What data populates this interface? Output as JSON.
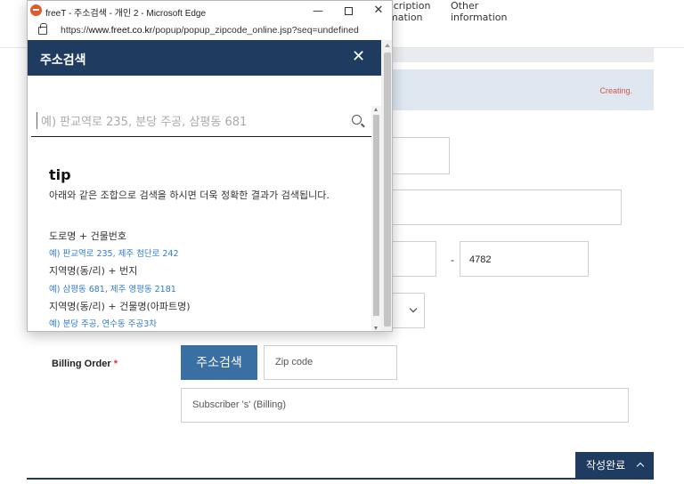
{
  "window": {
    "title": "freeT - 주소검색 - 개인 2 - Microsoft Edge",
    "url_prefix": "https://",
    "url_host": "www.freet.co.kr",
    "url_path": "/popup/popup_zipcode_online.jsp?seq=undefined",
    "controls": {
      "minimize": "—",
      "maximize": "",
      "close": "✕"
    }
  },
  "popup": {
    "header_title": "주소검색",
    "close": "✕",
    "search": {
      "placeholder": "예) 판교역로 235, 분당 주공, 삼평동 681"
    },
    "tip": {
      "title": "tip",
      "description": "아래와 같은 조합으로 검색을 하시면 더욱 정확한 결과가 검색됩니다.",
      "items": [
        {
          "heading": "도로명 + 건물번호",
          "example": "예) 판교역로 235,  제주 첨단로 242"
        },
        {
          "heading": "지역명(동/리) + 번지",
          "example": "예) 삼평동 681,  제주 영평동 2181"
        },
        {
          "heading": "지역명(동/리) + 건물명(아파트명)",
          "example": "예) 분당 주공,  연수동 주공3차"
        }
      ]
    }
  },
  "background": {
    "nav": {
      "item1": "scription\nmation",
      "item2": "Other\ninformation"
    },
    "status": "Creating.",
    "phone_dash": "-",
    "phone_last": "4782",
    "billing": {
      "label": "Billing Order",
      "required_mark": "*",
      "address_search_button": "주소검색",
      "zip_placeholder": "Zip code",
      "subscriber_placeholder": "Subscriber 's' (Billing)"
    },
    "complete_button": "작성완료"
  },
  "colors": {
    "navy": "#1f3b5f",
    "button_blue": "#3a6fa3",
    "example_blue": "#2f7bd3",
    "status_red": "#d9534f"
  }
}
